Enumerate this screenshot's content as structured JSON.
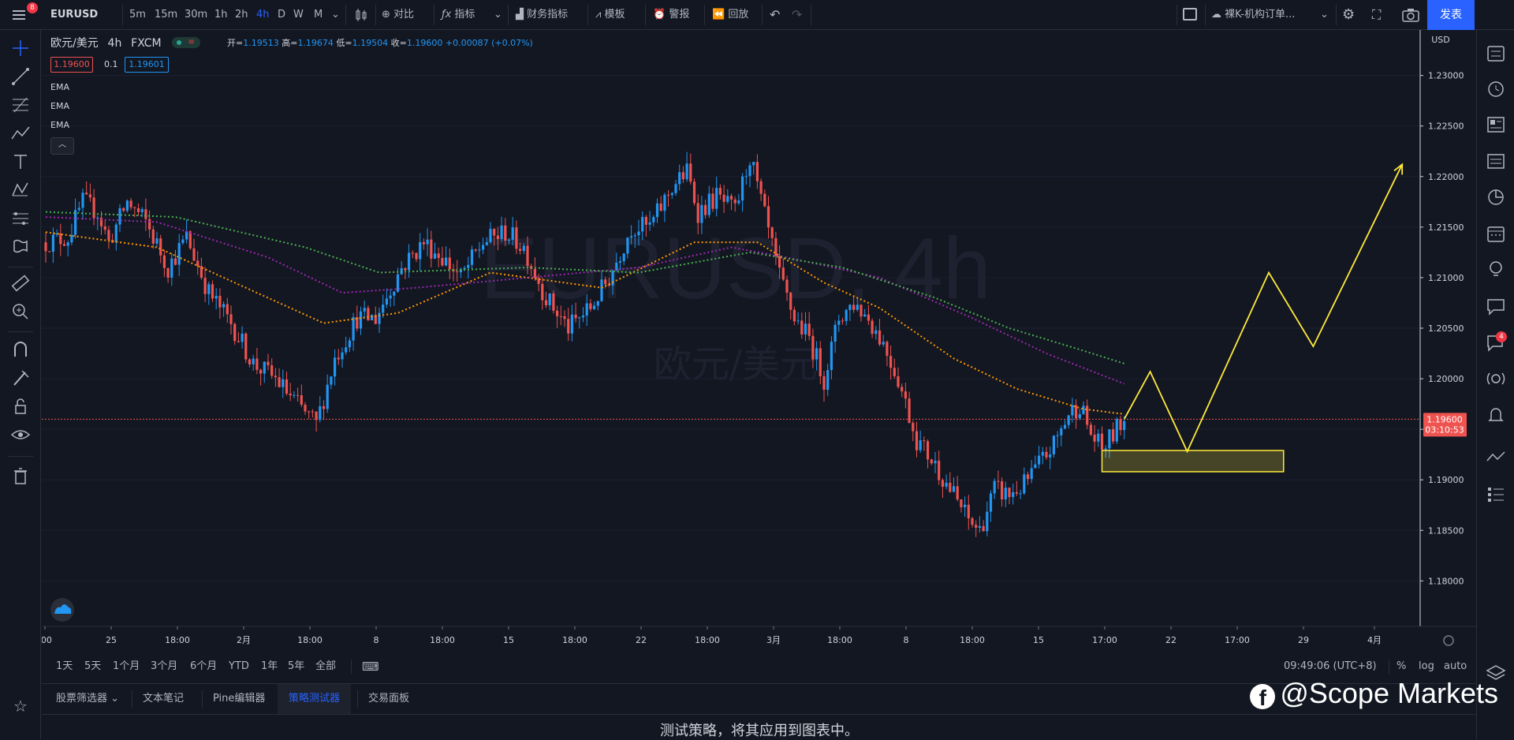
{
  "topbar": {
    "badge_count": "8",
    "symbol": "EURUSD",
    "intervals": [
      "5m",
      "15m",
      "30m",
      "1h",
      "2h",
      "4h",
      "D",
      "W",
      "M"
    ],
    "active_interval": "4h",
    "compare": "对比",
    "indicators": "指标",
    "financials": "财务指标",
    "templates": "模板",
    "alert": "警报",
    "replay": "回放",
    "layout_name": "裸K-机构订单...",
    "publish": "发表"
  },
  "legend": {
    "title": "欧元/美元",
    "interval": "4h",
    "source": "FXCM",
    "open_label": "开=",
    "open": "1.19513",
    "high_label": "高=",
    "high": "1.19674",
    "low_label": "低=",
    "low": "1.19504",
    "close_label": "收=",
    "close": "1.19600",
    "change": "+0.00087 (+0.07%)",
    "sell": "1.19600",
    "spread": "0.1",
    "buy": "1.19601",
    "indicators": [
      "EMA",
      "EMA",
      "EMA"
    ]
  },
  "chart_data": {
    "type": "candlestick",
    "watermark_symbol": "EURUSD, 4h",
    "watermark_name": "欧元/美元",
    "currency": "USD",
    "ylim": [
      1.1755,
      1.2345
    ],
    "y_ticks": [
      "1.23000",
      "1.22500",
      "1.22000",
      "1.21500",
      "1.21000",
      "1.20500",
      "1.20000",
      "1.19500",
      "1.19000",
      "1.18500",
      "1.18000"
    ],
    "x_ticks": [
      ":00",
      "25",
      "18:00",
      "2月",
      "18:00",
      "8",
      "18:00",
      "15",
      "18:00",
      "22",
      "18:00",
      "3月",
      "18:00",
      "8",
      "18:00",
      "15",
      "17:00",
      "22",
      "17:00",
      "29",
      "4月"
    ],
    "last_price": "1.19600",
    "countdown": "03:10:53",
    "colors": {
      "up": "#2196f3",
      "down": "#ef5350",
      "ema_fast": "#ff9800",
      "ema_mid": "#9c27b0",
      "ema_slow": "#4caf50",
      "drawing": "#ffeb3b"
    },
    "anchors": [
      [
        0,
        1.2135
      ],
      [
        6,
        1.214
      ],
      [
        10,
        1.2175
      ],
      [
        14,
        1.2165
      ],
      [
        17,
        1.2135
      ],
      [
        22,
        1.2175
      ],
      [
        27,
        1.2155
      ],
      [
        33,
        1.211
      ],
      [
        38,
        1.214
      ],
      [
        44,
        1.2085
      ],
      [
        50,
        1.2055
      ],
      [
        56,
        1.2015
      ],
      [
        62,
        1.2
      ],
      [
        69,
        1.197
      ],
      [
        73,
        1.1955
      ],
      [
        78,
        1.202
      ],
      [
        84,
        1.206
      ],
      [
        89,
        1.206
      ],
      [
        96,
        1.211
      ],
      [
        102,
        1.2135
      ],
      [
        107,
        1.212
      ],
      [
        112,
        1.21
      ],
      [
        118,
        1.2135
      ],
      [
        124,
        1.2145
      ],
      [
        129,
        1.213
      ],
      [
        135,
        1.208
      ],
      [
        141,
        1.205
      ],
      [
        147,
        1.207
      ],
      [
        152,
        1.21
      ],
      [
        158,
        1.215
      ],
      [
        163,
        1.215
      ],
      [
        169,
        1.219
      ],
      [
        173,
        1.2205
      ],
      [
        176,
        1.2165
      ],
      [
        181,
        1.218
      ],
      [
        186,
        1.2165
      ],
      [
        190,
        1.222
      ],
      [
        194,
        1.216
      ],
      [
        198,
        1.21
      ],
      [
        202,
        1.206
      ],
      [
        206,
        1.204
      ],
      [
        210,
        1.2
      ],
      [
        214,
        1.206
      ],
      [
        218,
        1.2075
      ],
      [
        222,
        1.206
      ],
      [
        226,
        1.2035
      ],
      [
        230,
        1.2
      ],
      [
        235,
        1.194
      ],
      [
        240,
        1.1915
      ],
      [
        245,
        1.1885
      ],
      [
        249,
        1.186
      ],
      [
        252,
        1.185
      ],
      [
        256,
        1.189
      ],
      [
        260,
        1.1885
      ],
      [
        264,
        1.1895
      ],
      [
        268,
        1.1915
      ],
      [
        272,
        1.1935
      ],
      [
        276,
        1.1965
      ],
      [
        279,
        1.1975
      ],
      [
        282,
        1.1945
      ],
      [
        285,
        1.193
      ],
      [
        288,
        1.1945
      ],
      [
        291,
        1.196
      ]
    ],
    "ema_fast": [
      [
        0,
        1.2145
      ],
      [
        30,
        1.213
      ],
      [
        60,
        1.208
      ],
      [
        75,
        1.2055
      ],
      [
        95,
        1.2065
      ],
      [
        120,
        1.2105
      ],
      [
        150,
        1.209
      ],
      [
        175,
        1.2135
      ],
      [
        192,
        1.2135
      ],
      [
        210,
        1.2095
      ],
      [
        225,
        1.207
      ],
      [
        245,
        1.202
      ],
      [
        262,
        1.199
      ],
      [
        280,
        1.197
      ],
      [
        291,
        1.1965
      ]
    ],
    "ema_mid": [
      [
        0,
        1.216
      ],
      [
        30,
        1.2155
      ],
      [
        60,
        1.212
      ],
      [
        80,
        1.2085
      ],
      [
        100,
        1.209
      ],
      [
        130,
        1.21
      ],
      [
        160,
        1.211
      ],
      [
        185,
        1.213
      ],
      [
        200,
        1.212
      ],
      [
        225,
        1.21
      ],
      [
        250,
        1.206
      ],
      [
        270,
        1.2025
      ],
      [
        291,
        1.1995
      ]
    ],
    "ema_slow": [
      [
        0,
        1.2165
      ],
      [
        35,
        1.216
      ],
      [
        70,
        1.213
      ],
      [
        90,
        1.2105
      ],
      [
        130,
        1.211
      ],
      [
        160,
        1.2105
      ],
      [
        190,
        1.2125
      ],
      [
        215,
        1.211
      ],
      [
        240,
        1.208
      ],
      [
        260,
        1.205
      ],
      [
        278,
        1.203
      ],
      [
        291,
        1.2015
      ]
    ],
    "drawing_path_idx": [
      [
        291,
        1.196
      ],
      [
        298,
        1.2007
      ],
      [
        308,
        1.1928
      ],
      [
        330,
        1.2105
      ],
      [
        342,
        1.2032
      ],
      [
        366,
        1.2212
      ]
    ],
    "zone": {
      "from_idx": 285,
      "to_idx": 334,
      "top": 1.1929,
      "bottom": 1.1908
    }
  },
  "ranges": {
    "items": [
      "1天",
      "5天",
      "1个月",
      "3个月",
      "6个月",
      "YTD",
      "1年",
      "5年",
      "全部"
    ],
    "time": "09:49:06 (UTC+8)",
    "pct": "%",
    "log": "log",
    "auto": "auto"
  },
  "bottom": {
    "tabs": [
      "股票筛选器",
      "文本笔记",
      "Pine编辑器",
      "策略测试器",
      "交易面板"
    ],
    "active": "策略测试器",
    "message": "测试策略，将其应用到图表中。",
    "watermark": "@Scope Markets",
    "alerts_badge": "4"
  }
}
